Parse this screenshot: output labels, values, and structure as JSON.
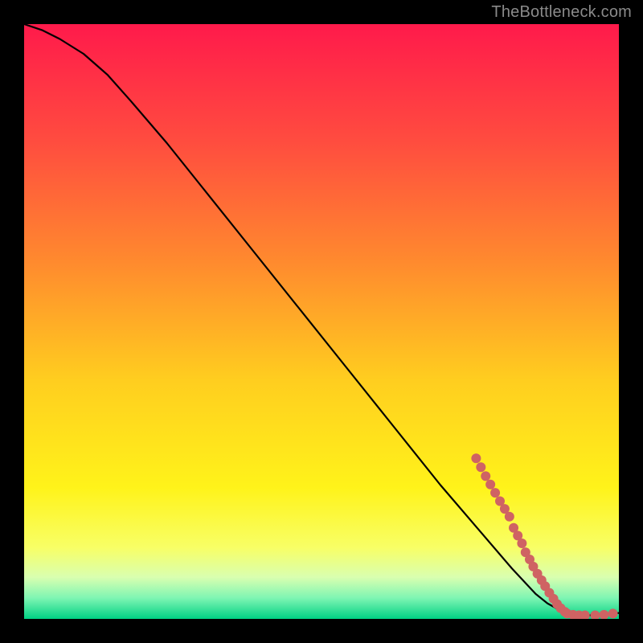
{
  "watermark": "TheBottleneck.com",
  "chart_data": {
    "type": "line",
    "title": "",
    "xlabel": "",
    "ylabel": "",
    "xlim": [
      0,
      100
    ],
    "ylim": [
      0,
      100
    ],
    "grid": false,
    "legend": false,
    "background_gradient": {
      "stops": [
        {
          "offset": 0.0,
          "color": "#ff1a4b"
        },
        {
          "offset": 0.2,
          "color": "#ff4d3f"
        },
        {
          "offset": 0.4,
          "color": "#ff8a2e"
        },
        {
          "offset": 0.6,
          "color": "#ffce1f"
        },
        {
          "offset": 0.78,
          "color": "#fff31a"
        },
        {
          "offset": 0.88,
          "color": "#f8ff66"
        },
        {
          "offset": 0.93,
          "color": "#d9ffb0"
        },
        {
          "offset": 0.965,
          "color": "#7ef5b3"
        },
        {
          "offset": 1.0,
          "color": "#00d184"
        }
      ]
    },
    "series": [
      {
        "name": "curve",
        "type": "line",
        "color": "#000000",
        "x": [
          0,
          3,
          6,
          10,
          14,
          18,
          24,
          30,
          38,
          46,
          54,
          62,
          70,
          76,
          82,
          86,
          88,
          90,
          92,
          94,
          96,
          98,
          100
        ],
        "y": [
          100,
          99,
          97.5,
          95,
          91.5,
          87,
          80,
          72.5,
          62.5,
          52.5,
          42.5,
          32.5,
          22.5,
          15.5,
          8.5,
          4.2,
          2.6,
          1.5,
          0.9,
          0.6,
          0.6,
          0.7,
          1.0
        ]
      },
      {
        "name": "dots",
        "type": "scatter",
        "color": "#cf6363",
        "radius": 6,
        "points": [
          {
            "x": 76.0,
            "y": 27.0
          },
          {
            "x": 76.8,
            "y": 25.5
          },
          {
            "x": 77.6,
            "y": 24.0
          },
          {
            "x": 78.4,
            "y": 22.6
          },
          {
            "x": 79.2,
            "y": 21.2
          },
          {
            "x": 80.0,
            "y": 19.8
          },
          {
            "x": 80.8,
            "y": 18.5
          },
          {
            "x": 81.6,
            "y": 17.2
          },
          {
            "x": 82.3,
            "y": 15.3
          },
          {
            "x": 83.0,
            "y": 14.0
          },
          {
            "x": 83.7,
            "y": 12.7
          },
          {
            "x": 84.3,
            "y": 11.2
          },
          {
            "x": 85.0,
            "y": 10.0
          },
          {
            "x": 85.6,
            "y": 8.8
          },
          {
            "x": 86.3,
            "y": 7.6
          },
          {
            "x": 87.0,
            "y": 6.5
          },
          {
            "x": 87.6,
            "y": 5.5
          },
          {
            "x": 88.3,
            "y": 4.4
          },
          {
            "x": 89.0,
            "y": 3.4
          },
          {
            "x": 89.6,
            "y": 2.5
          },
          {
            "x": 90.2,
            "y": 1.8
          },
          {
            "x": 90.9,
            "y": 1.2
          },
          {
            "x": 91.3,
            "y": 0.9
          },
          {
            "x": 92.3,
            "y": 0.7
          },
          {
            "x": 93.3,
            "y": 0.6
          },
          {
            "x": 94.3,
            "y": 0.6
          },
          {
            "x": 96.0,
            "y": 0.6
          },
          {
            "x": 97.5,
            "y": 0.7
          },
          {
            "x": 99.0,
            "y": 0.9
          }
        ]
      }
    ]
  }
}
